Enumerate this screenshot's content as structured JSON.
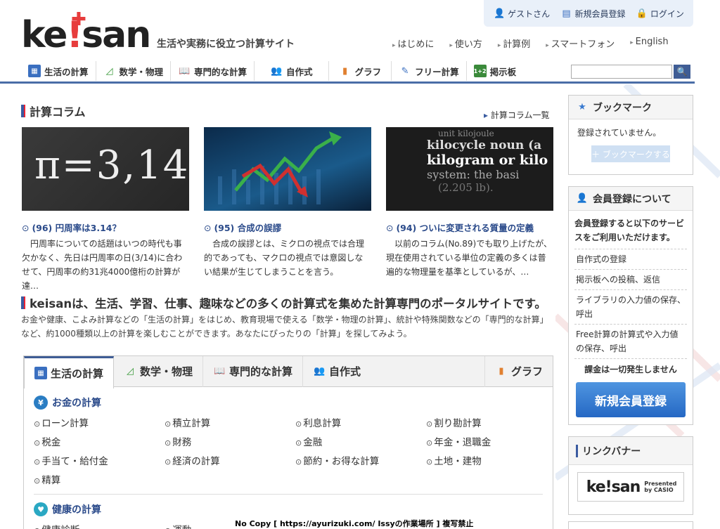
{
  "user_bar": {
    "guest": "ゲストさん",
    "register": "新規会員登録",
    "login": "ログイン"
  },
  "logo": {
    "text": "ke!san"
  },
  "tagline": "生活や実務に役立つ計算サイト",
  "top_nav": [
    "はじめに",
    "使い方",
    "計算例",
    "スマートフォン",
    "English"
  ],
  "main_nav": [
    {
      "label": "生活の計算",
      "icon": "calculator-icon"
    },
    {
      "label": "数学・物理",
      "icon": "triangle-ruler-icon"
    },
    {
      "label": "専門的な計算",
      "icon": "open-book-icon"
    },
    {
      "label": "自作式",
      "icon": "people-icon"
    },
    {
      "label": "グラフ",
      "icon": "bar-chart-icon"
    },
    {
      "label": "フリー計算",
      "icon": "pencil-memo-icon"
    },
    {
      "label": "掲示板",
      "icon": "board-icon"
    }
  ],
  "search": {
    "placeholder": "",
    "button": "search-icon"
  },
  "column": {
    "title": "計算コラム",
    "list_link": "計算コラム一覧",
    "articles": [
      {
        "title": "(96) 円周率は3.14？",
        "desc": "円周率についての話題はいつの時代も事欠かなく、先日は円周率の日(3/14)に合わせて、円周率の約31兆4000億桁の計算が達…",
        "img_text": "π=3,14"
      },
      {
        "title": "(95) 合成の誤謬",
        "desc": "合成の誤謬とは、ミクロの視点では合理的であっても、マクロの視点では意図しない結果が生じてしまうことを言う。",
        "img_text": ""
      },
      {
        "title": "(94) ついに変更される質量の定義",
        "desc": "以前のコラム(No.89)でも取り上げたが、現在使用されている単位の定義の多くは普遍的な物理量を基準としているが、…",
        "img_lines": [
          "unit kilojoule",
          "kilocycle noun (a",
          "kilogram or kilo",
          "system: the basi",
          "(2.205 lb)."
        ]
      }
    ]
  },
  "lead": {
    "heading": "keisanは、生活、学習、仕事、趣味などの多くの計算式を集めた計算専門のポータルサイトです。",
    "text": "お金や健康、こよみ計算などの「生活の計算」をはじめ、教育現場で使える「数学・物理の計算」、統計や特殊関数などの「専門的な計算」など、約1000種類以上の計算を楽しむことができます。あなたにぴったりの「計算」を探してみよう。"
  },
  "tabs": [
    {
      "label": "生活の計算",
      "active": true
    },
    {
      "label": "数学・物理",
      "active": false
    },
    {
      "label": "専門的な計算",
      "active": false
    },
    {
      "label": "自作式",
      "active": false
    },
    {
      "label": "グラフ",
      "active": false
    }
  ],
  "categories": [
    {
      "title": "お金の計算",
      "items": [
        "ローン計算",
        "積立計算",
        "利息計算",
        "割り勘計算",
        "税金",
        "財務",
        "金融",
        "年金・退職金",
        "手当て・給付金",
        "経済の計算",
        "節約・お得な計算",
        "土地・建物",
        "精算"
      ]
    },
    {
      "title": "健康の計算",
      "items": [
        "健康診断",
        "運動"
      ]
    }
  ],
  "sidebar": {
    "bookmark": {
      "title": "ブックマーク",
      "empty": "登録されていません。",
      "button": "＋ ブックマークする"
    },
    "member": {
      "title": "会員登録について",
      "lead": "会員登録すると以下のサービスをご利用いただけます。",
      "items": [
        "自作式の登録",
        "掲示板への投稿、返信",
        "ライブラリの入力値の保存、呼出",
        "Free計算の計算式や入力値の保存、呼出"
      ],
      "free": "課金は一切発生しません",
      "button": "新規会員登録"
    },
    "banner": {
      "title": "リンクバナー",
      "logo_text": "ke!san",
      "sub": "Presented by CASIO"
    }
  },
  "watermark": "No Copy [ https://ayurizuki.com/ Issyの作業場所 ] 複写禁止"
}
